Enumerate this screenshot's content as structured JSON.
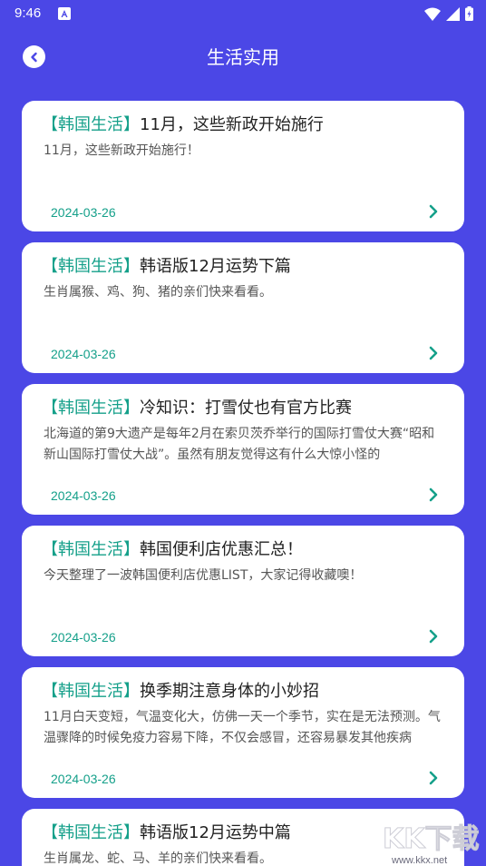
{
  "status": {
    "time": "9:46"
  },
  "header": {
    "title": "生活实用"
  },
  "articles": [
    {
      "tag": "【韩国生活】",
      "title": "11月，这些新政开始施行",
      "summary": "11月，这些新政开始施行！",
      "date": "2024-03-26"
    },
    {
      "tag": "【韩国生活】",
      "title": "韩语版12月运势下篇",
      "summary": "生肖属猴、鸡、狗、猪的亲们快来看看。",
      "date": "2024-03-26"
    },
    {
      "tag": "【韩国生活】",
      "title": "冷知识：打雪仗也有官方比赛",
      "summary": "北海道的第9大遗产是每年2月在索贝茨乔举行的国际打雪仗大赛“昭和新山国际打雪仗大战”。虽然有朋友觉得这有什么大惊小怪的",
      "date": "2024-03-26"
    },
    {
      "tag": "【韩国生活】",
      "title": "韩国便利店优惠汇总！",
      "summary": "今天整理了一波韩国便利店优惠LIST，大家记得收藏噢！",
      "date": "2024-03-26"
    },
    {
      "tag": "【韩国生活】",
      "title": "换季期注意身体的小妙招",
      "summary": "11月白天变短，气温变化大，仿佛一天一个季节，实在是无法预测。气温骤降的时候免疫力容易下降，不仅会感冒，还容易暴发其他疾病",
      "date": "2024-03-26"
    },
    {
      "tag": "【韩国生活】",
      "title": "韩语版12月运势中篇",
      "summary": "生肖属龙、蛇、马、羊的亲们快来看看。",
      "date": ""
    }
  ],
  "watermark": {
    "brand": "KK下载",
    "url": "www.kkx.net"
  },
  "colors": {
    "background": "#4b47e6",
    "accent": "#15a08a",
    "card": "#ffffff"
  }
}
